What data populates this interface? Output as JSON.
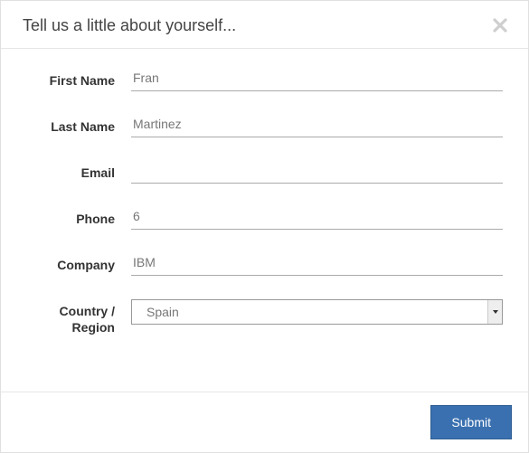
{
  "header": {
    "title": "Tell us a little about yourself..."
  },
  "fields": {
    "first_name": {
      "label": "First Name",
      "value": "Fran"
    },
    "last_name": {
      "label": "Last Name",
      "value": "Martinez"
    },
    "email": {
      "label": "Email",
      "value": ""
    },
    "phone": {
      "label": "Phone",
      "value": "6"
    },
    "company": {
      "label": "Company",
      "value": "IBM"
    },
    "country": {
      "label": "Country / Region",
      "value": "Spain"
    }
  },
  "actions": {
    "submit": "Submit"
  }
}
